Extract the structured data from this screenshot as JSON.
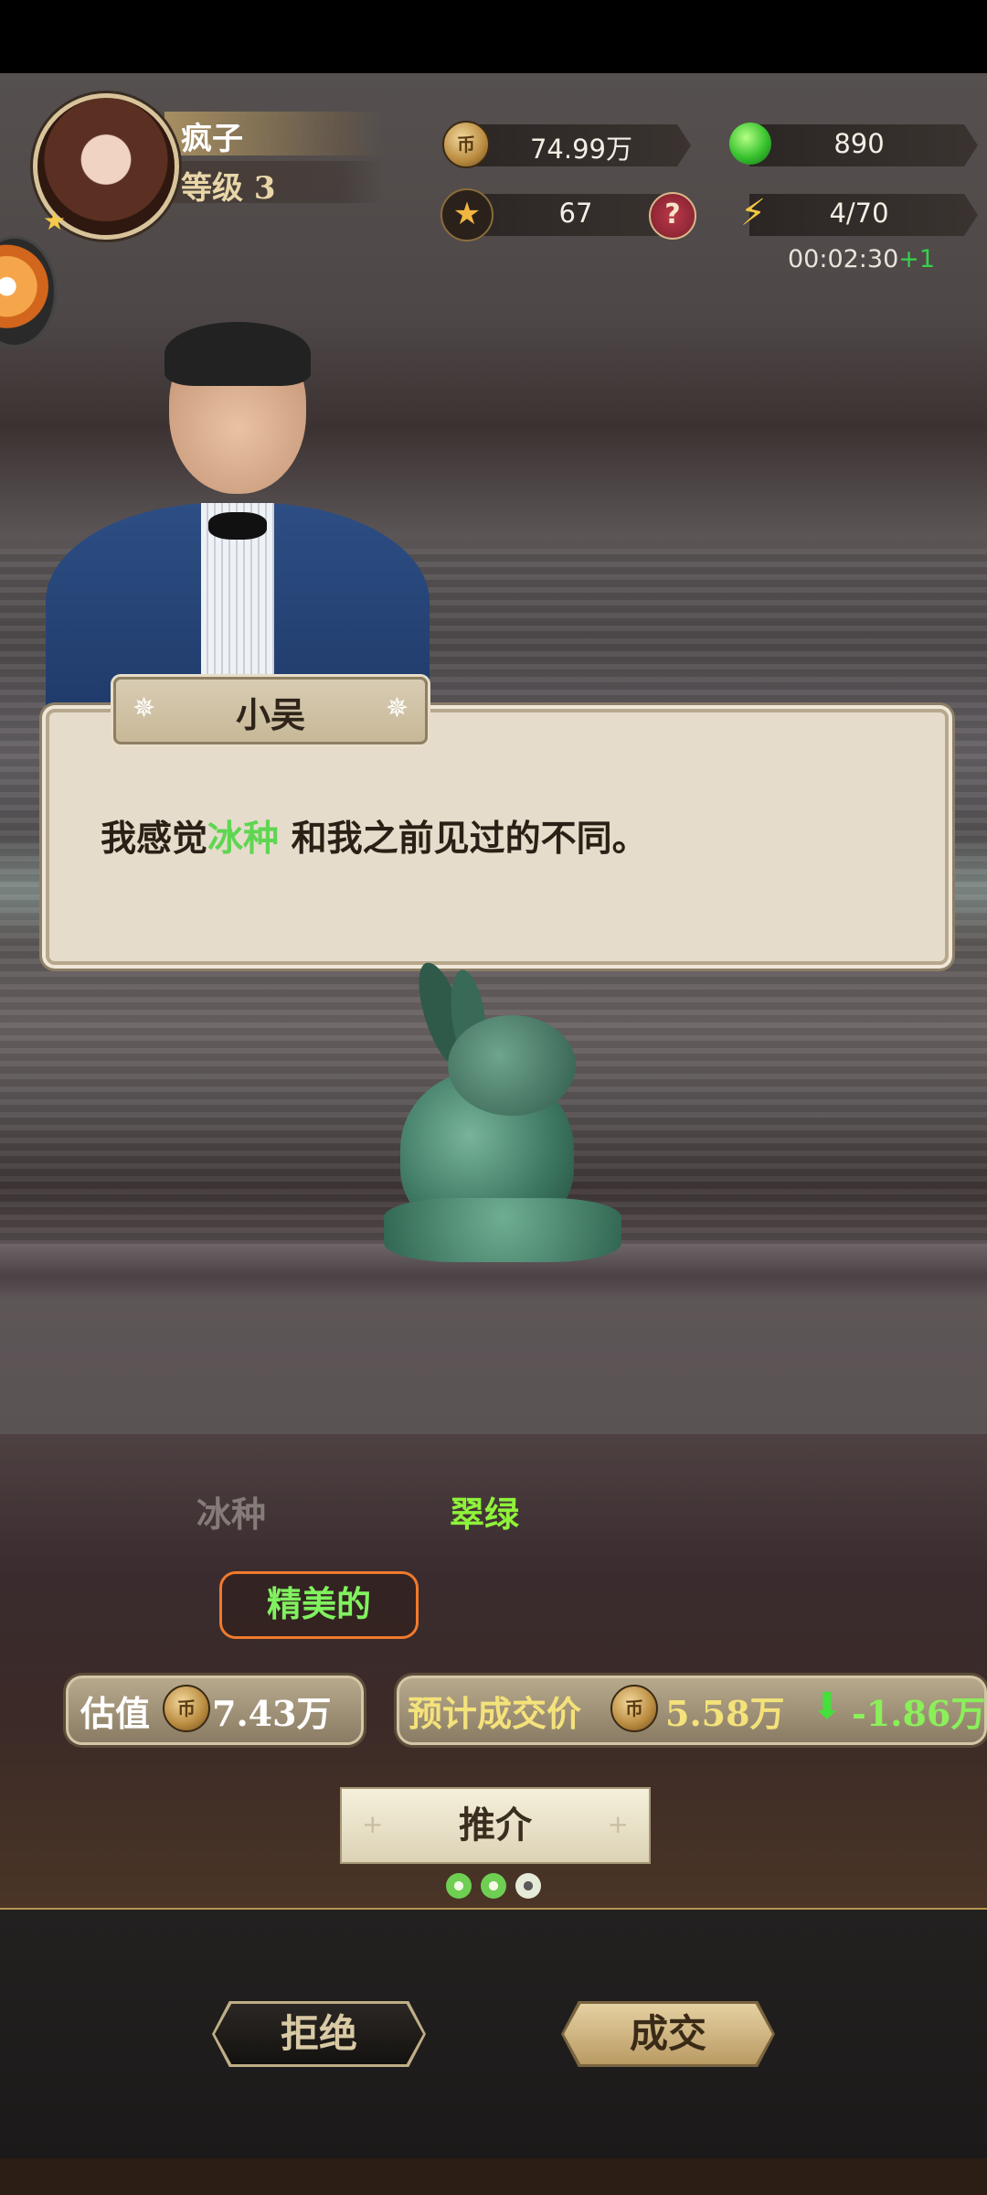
{
  "player": {
    "name": "疯子",
    "level": "等级 3"
  },
  "stats": {
    "coins": "74.99万",
    "gems": "890",
    "stars": "67",
    "energy": "4/70",
    "timer": "00:02:30",
    "timer_bonus": "+1"
  },
  "dialog": {
    "speaker": "小吴",
    "text_before": "我感觉",
    "text_highlight": "冰种",
    "text_after": " 和我之前见过的不同。"
  },
  "item": {
    "attr1": "冰种",
    "attr2": "翠绿",
    "quality": "精美的"
  },
  "valuation": {
    "label": "估值",
    "value": "7.43万"
  },
  "expected": {
    "label": "预计成交价",
    "value": "5.58万",
    "diff": "-1.86万"
  },
  "actions": {
    "recommend": "推介",
    "reject": "拒绝",
    "deal": "成交"
  },
  "recommend_uses": {
    "remaining": 2,
    "total": 3
  },
  "colors": {
    "highlight_green": "#5ed652",
    "gold_border": "#b7954e",
    "quality_border": "#f07a2c"
  }
}
